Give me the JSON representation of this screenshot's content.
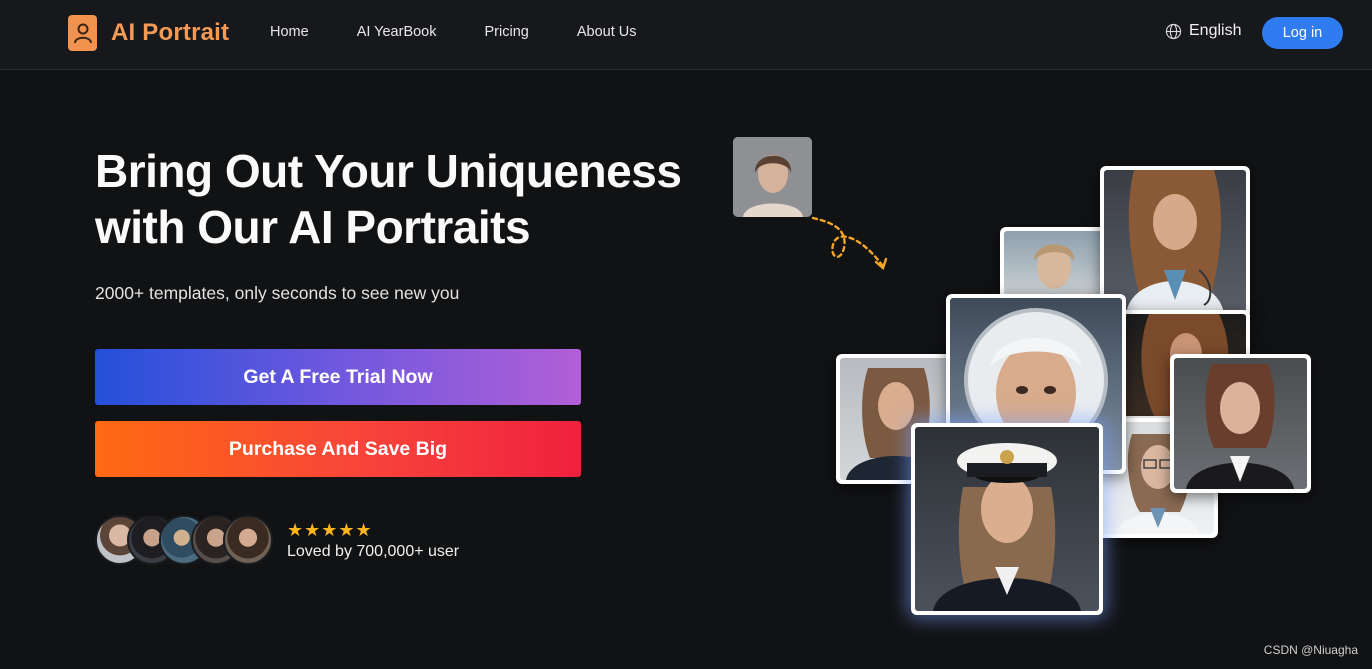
{
  "header": {
    "logo_text": "AI Portrait",
    "nav": [
      {
        "label": "Home"
      },
      {
        "label": "AI YearBook"
      },
      {
        "label": "Pricing"
      },
      {
        "label": "About Us"
      }
    ],
    "language": "English",
    "login_label": "Log in"
  },
  "hero": {
    "title_line1": "Bring Out Your Uniqueness",
    "title_line2": "with Our AI Portraits",
    "subtitle": "2000+ templates, only seconds to see new you",
    "trial_button": "Get A Free Trial Now",
    "purchase_button": "Purchase And Save Big",
    "rating_stars": "★★★★★",
    "loved_text": "Loved by 700,000+ user"
  },
  "colors": {
    "brand_orange": "#f39a57",
    "login_blue": "#2f7cf0",
    "star": "#ffb51c"
  },
  "watermark": "CSDN @Niuagha"
}
